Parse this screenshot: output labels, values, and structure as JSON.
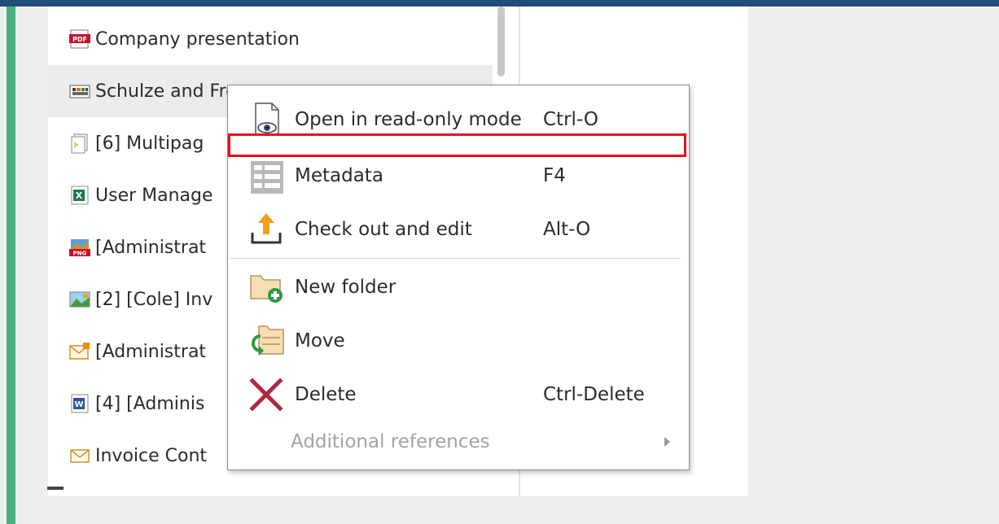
{
  "file_list": {
    "items": [
      {
        "label": "Company presentation",
        "icon": "pdf-icon",
        "selected": false
      },
      {
        "label": "Schulze and Fre",
        "icon": "video-icon",
        "selected": true
      },
      {
        "label": "[6] Multipag",
        "icon": "multipage-document-icon",
        "selected": false
      },
      {
        "label": "User Manage",
        "icon": "excel-icon",
        "selected": false
      },
      {
        "label": "[Administrat",
        "icon": "png-image-icon",
        "selected": false
      },
      {
        "label": "[2] [Cole] Inv",
        "icon": "image-icon",
        "selected": false
      },
      {
        "label": "[Administrat",
        "icon": "email-flagged-icon",
        "selected": false
      },
      {
        "label": "[4] [Adminis",
        "icon": "word-icon",
        "selected": false
      },
      {
        "label": "Invoice Cont",
        "icon": "email-icon",
        "selected": false
      }
    ]
  },
  "context_menu": {
    "items": [
      {
        "label": "Open in read-only mode",
        "shortcut": "Ctrl-O",
        "icon": "read-only-eye-icon",
        "enabled": true
      },
      {
        "label": "Metadata",
        "shortcut": "F4",
        "icon": "metadata-grid-icon",
        "enabled": true
      },
      {
        "label": "Check out and edit",
        "shortcut": "Alt-O",
        "icon": "check-out-upload-icon",
        "enabled": true
      },
      {
        "label": "New folder",
        "shortcut": "",
        "icon": "new-folder-icon",
        "enabled": true
      },
      {
        "label": "Move",
        "shortcut": "",
        "icon": "move-folder-icon",
        "enabled": true
      },
      {
        "label": "Delete",
        "shortcut": "Ctrl-Delete",
        "icon": "delete-x-icon",
        "enabled": true
      },
      {
        "label": "Additional references",
        "shortcut": "",
        "icon": "",
        "enabled": false,
        "has_submenu": true
      }
    ]
  },
  "colors": {
    "accent_top_bar": "#1f4e79",
    "left_bar": "#4caf80",
    "highlight_box": "#e3121b",
    "delete_icon": "#b0283c",
    "checkout_icon": "#f0a018"
  }
}
